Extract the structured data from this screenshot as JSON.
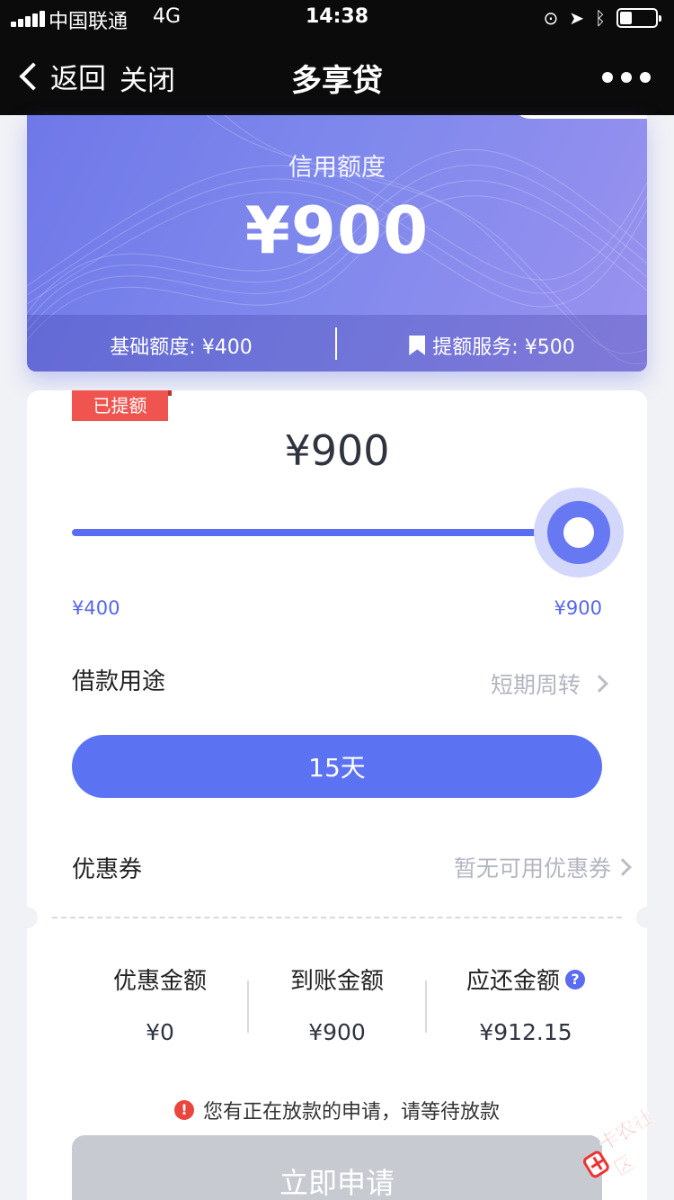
{
  "status_bar": {
    "carrier": "中国联通",
    "network": "4G",
    "time": "14:38",
    "battery_level": 0.35,
    "icons": [
      "orientation-lock-icon",
      "location-icon",
      "bluetooth-icon",
      "battery-icon"
    ]
  },
  "nav": {
    "back_label": "返回",
    "close_label": "关闭",
    "title": "多享贷"
  },
  "credit_card": {
    "label": "信用额度",
    "amount": "¥900",
    "base_quota": "基础额度: ¥400",
    "boost_service": "提额服务: ¥500"
  },
  "loan": {
    "badge": "已提额",
    "amount": "¥900",
    "slider": {
      "min_label": "¥400",
      "max_label": "¥900",
      "min": 400,
      "max": 900,
      "value": 900
    },
    "purpose": {
      "label": "借款用途",
      "value": "短期周转"
    },
    "term_button": "15天",
    "coupon": {
      "label": "优惠券",
      "value": "暂无可用优惠券"
    }
  },
  "summary": {
    "discount": {
      "label": "优惠金额",
      "value": "¥0"
    },
    "received": {
      "label": "到账金额",
      "value": "¥900"
    },
    "repay": {
      "label": "应还金额",
      "value": "¥912.15"
    },
    "help_glyph": "?"
  },
  "notice": {
    "glyph": "!",
    "text": "您有正在放款的申请，请等待放款"
  },
  "apply_button": "立即申请",
  "watermark": {
    "text": "卡农社区"
  },
  "colors": {
    "accent": "#5b73f3",
    "badge": "#f0544f",
    "disabled": "#c8cad2",
    "warning": "#e8463f"
  }
}
